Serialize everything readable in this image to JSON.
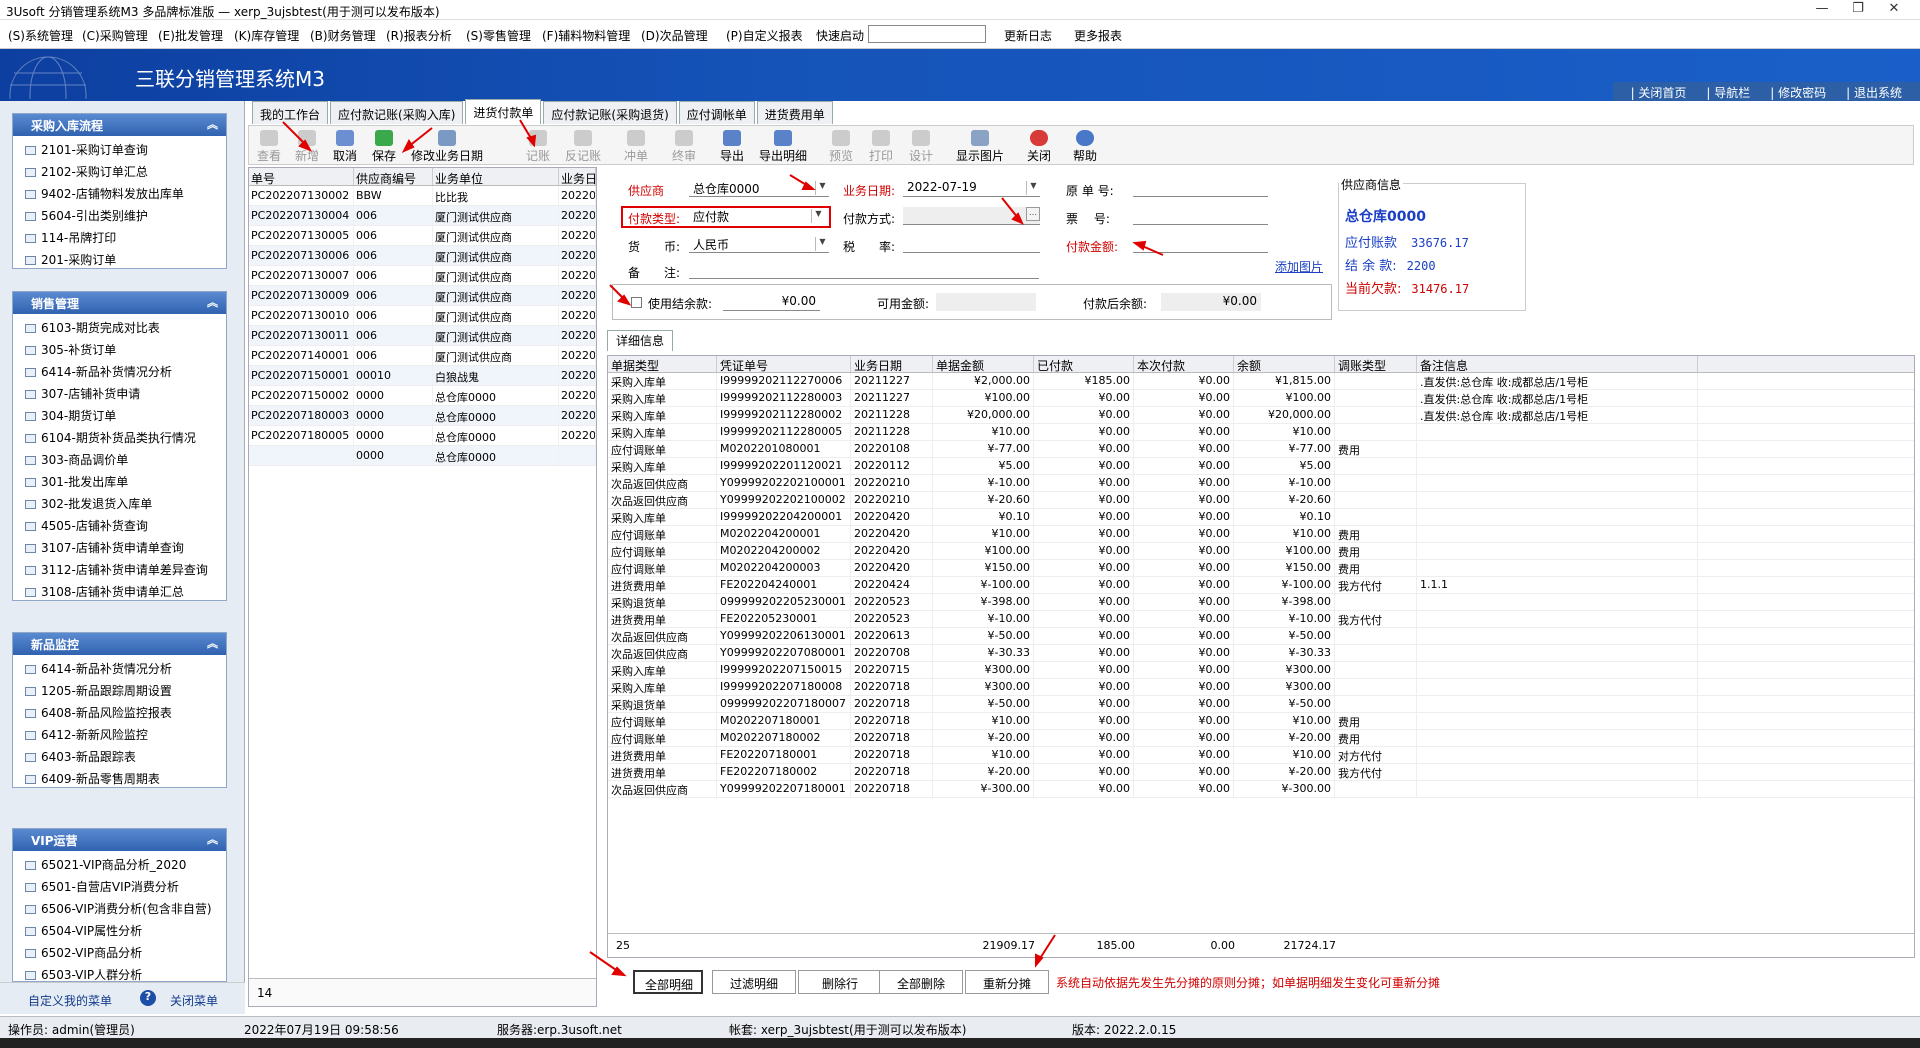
{
  "window": {
    "title": "3Usoft 分销管理系统M3 多品牌标准版 — xerp_3ujsbtest(用于测可以发布版本)"
  },
  "menu": [
    "(S)系统管理",
    "(C)采购管理",
    "(E)批发管理",
    "(K)库存管理",
    "(B)财务管理",
    "(R)报表分析",
    "(S)零售管理",
    "(F)辅料物料管理",
    "(D)次品管理",
    "(P)自定义报表"
  ],
  "quick_label": "快速启动",
  "menu_right": [
    "更新日志",
    "更多报表"
  ],
  "app_name": "三联分销管理系统M3",
  "top_links": [
    "| 关闭首页",
    "| 导航栏",
    "| 修改密码",
    "| 退出系统"
  ],
  "left_sections": [
    {
      "title": "采购入库流程",
      "items": [
        "2101-采购订单查询",
        "2102-采购订单汇总",
        "9402-店铺物料发放出库单",
        "5604-引出类别维护",
        "114-吊牌打印",
        "201-采购订单"
      ]
    },
    {
      "title": "销售管理",
      "items": [
        "6103-期货完成对比表",
        "305-补货订单",
        "6414-新品补货情况分析",
        "307-店铺补货申请",
        "304-期货订单",
        "6104-期货补货品类执行情况",
        "303-商品调价单",
        "301-批发出库单",
        "302-批发退货入库单",
        "4505-店铺补货查询",
        "3107-店铺补货申请单查询",
        "3112-店铺补货申请单差异查询",
        "3108-店铺补货申请单汇总"
      ]
    },
    {
      "title": "新品监控",
      "items": [
        "6414-新品补货情况分析",
        "1205-新品跟踪周期设置",
        "6408-新品风险监控报表",
        "6412-新新风险监控",
        "6403-新品跟踪表",
        "6409-新品零售周期表"
      ]
    },
    {
      "title": "VIP运营",
      "items": [
        "65021-VIP商品分析_2020",
        "6501-自营店VIP消费分析",
        "6506-VIP消费分析(包含非自营)",
        "6504-VIP属性分析",
        "6502-VIP商品分析",
        "6503-VIP人群分析"
      ]
    }
  ],
  "left_footer": {
    "custom": "自定义我的菜单",
    "close": "关闭菜单"
  },
  "tabs": [
    "我的工作台",
    "应付款记账(采购入库)",
    "进货付款单",
    "应付款记账(采购退货)",
    "应付调帐单",
    "进货费用单"
  ],
  "toolbar": [
    "查看",
    "新增",
    "取消",
    "保存",
    "修改业务日期",
    "记账",
    "反记账",
    "冲单",
    "终审",
    "导出",
    "导出明细",
    "预览",
    "打印",
    "设计",
    "显示图片",
    "关闭",
    "帮助"
  ],
  "list": {
    "headers": [
      "单号",
      "供应商编号",
      "业务单位",
      "业务日"
    ],
    "rows": [
      [
        "PC202207130002",
        "BBW",
        "比比我",
        "20220"
      ],
      [
        "PC202207130004",
        "006",
        "厦门测试供应商",
        "20220"
      ],
      [
        "PC202207130005",
        "006",
        "厦门测试供应商",
        "20220"
      ],
      [
        "PC202207130006",
        "006",
        "厦门测试供应商",
        "20220"
      ],
      [
        "PC202207130007",
        "006",
        "厦门测试供应商",
        "20220"
      ],
      [
        "PC202207130009",
        "006",
        "厦门测试供应商",
        "20220"
      ],
      [
        "PC202207130010",
        "006",
        "厦门测试供应商",
        "20220"
      ],
      [
        "PC202207130011",
        "006",
        "厦门测试供应商",
        "20220"
      ],
      [
        "PC202207140001",
        "006",
        "厦门测试供应商",
        "20220"
      ],
      [
        "PC202207150001",
        "00010",
        "白狼战鬼",
        "20220"
      ],
      [
        "PC202207150002",
        "0000",
        "总仓库0000",
        "20220"
      ],
      [
        "PC202207180003",
        "0000",
        "总仓库0000",
        "20220"
      ],
      [
        "PC202207180005",
        "0000",
        "总仓库0000",
        "20220"
      ],
      [
        "",
        "0000",
        "总仓库0000",
        ""
      ]
    ],
    "count": "14"
  },
  "form": {
    "supplier_label": "供应商",
    "supplier_value": "总仓库0000",
    "bizdate_label": "业务日期:",
    "bizdate_value": "2022-07-19",
    "orig_label": "原 单 号:",
    "paytype_label": "付款类型:",
    "paytype_value": "应付款",
    "paymethod_label": "付款方式:",
    "ticket_label": "票　 号:",
    "currency_label": "货　　币:",
    "currency_value": "人民币",
    "tax_label": "税　　率:",
    "amount_label": "付款金额:",
    "remark_label": "备　　注:",
    "add_image": "添加图片",
    "use_balance_label": "使用结余款:",
    "use_balance_value": "¥0.00",
    "available_label": "可用金额:",
    "after_label": "付款后余额:",
    "after_value": "¥0.00"
  },
  "supplier_info": {
    "title": "供应商信息",
    "name": "总仓库0000",
    "payable_label": "应付账款",
    "payable_value": "33676.17",
    "balance_label": "结 余 款:",
    "balance_value": "2200",
    "owed_label": "当前欠款:",
    "owed_value": "31476.17"
  },
  "detail_tab": "详细信息",
  "detail": {
    "headers": [
      "单据类型",
      "凭证单号",
      "业务日期",
      "单据金额",
      "已付款",
      "本次付款",
      "余额",
      "调账类型",
      "备注信息"
    ],
    "rows": [
      [
        "采购入库单",
        "I99999202112270006",
        "20211227",
        "¥2,000.00",
        "¥185.00",
        "¥0.00",
        "¥1,815.00",
        "",
        ".直发供:总仓库 收:成都总店/1号柜"
      ],
      [
        "采购入库单",
        "I99999202112280003",
        "20211227",
        "¥100.00",
        "¥0.00",
        "¥0.00",
        "¥100.00",
        "",
        ".直发供:总仓库 收:成都总店/1号柜"
      ],
      [
        "采购入库单",
        "I99999202112280002",
        "20211228",
        "¥20,000.00",
        "¥0.00",
        "¥0.00",
        "¥20,000.00",
        "",
        ".直发供:总仓库 收:成都总店/1号柜"
      ],
      [
        "采购入库单",
        "I99999202112280005",
        "20211228",
        "¥10.00",
        "¥0.00",
        "¥0.00",
        "¥10.00",
        "",
        ""
      ],
      [
        "应付调账单",
        "M0202201080001",
        "20220108",
        "¥-77.00",
        "¥0.00",
        "¥0.00",
        "¥-77.00",
        "费用",
        ""
      ],
      [
        "采购入库单",
        "I99999202201120021",
        "20220112",
        "¥5.00",
        "¥0.00",
        "¥0.00",
        "¥5.00",
        "",
        ""
      ],
      [
        "次品返回供应商",
        "Y09999202202100001",
        "20220210",
        "¥-10.00",
        "¥0.00",
        "¥0.00",
        "¥-10.00",
        "",
        ""
      ],
      [
        "次品返回供应商",
        "Y09999202202100002",
        "20220210",
        "¥-20.60",
        "¥0.00",
        "¥0.00",
        "¥-20.60",
        "",
        ""
      ],
      [
        "采购入库单",
        "I99999202204200001",
        "20220420",
        "¥0.10",
        "¥0.00",
        "¥0.00",
        "¥0.10",
        "",
        ""
      ],
      [
        "应付调账单",
        "M0202204200001",
        "20220420",
        "¥10.00",
        "¥0.00",
        "¥0.00",
        "¥10.00",
        "费用",
        ""
      ],
      [
        "应付调账单",
        "M0202204200002",
        "20220420",
        "¥100.00",
        "¥0.00",
        "¥0.00",
        "¥100.00",
        "费用",
        ""
      ],
      [
        "应付调账单",
        "M0202204200003",
        "20220420",
        "¥150.00",
        "¥0.00",
        "¥0.00",
        "¥150.00",
        "费用",
        ""
      ],
      [
        "进货费用单",
        "FE202204240001",
        "20220424",
        "¥-100.00",
        "¥0.00",
        "¥0.00",
        "¥-100.00",
        "我方代付",
        "1.1.1"
      ],
      [
        "采购退货单",
        "099999202205230001",
        "20220523",
        "¥-398.00",
        "¥0.00",
        "¥0.00",
        "¥-398.00",
        "",
        ""
      ],
      [
        "进货费用单",
        "FE202205230001",
        "20220523",
        "¥-10.00",
        "¥0.00",
        "¥0.00",
        "¥-10.00",
        "我方代付",
        ""
      ],
      [
        "次品返回供应商",
        "Y09999202206130001",
        "20220613",
        "¥-50.00",
        "¥0.00",
        "¥0.00",
        "¥-50.00",
        "",
        ""
      ],
      [
        "次品返回供应商",
        "Y09999202207080001",
        "20220708",
        "¥-30.33",
        "¥0.00",
        "¥0.00",
        "¥-30.33",
        "",
        ""
      ],
      [
        "采购入库单",
        "I99999202207150015",
        "20220715",
        "¥300.00",
        "¥0.00",
        "¥0.00",
        "¥300.00",
        "",
        ""
      ],
      [
        "采购入库单",
        "I99999202207180008",
        "20220718",
        "¥300.00",
        "¥0.00",
        "¥0.00",
        "¥300.00",
        "",
        ""
      ],
      [
        "采购退货单",
        "099999202207180007",
        "20220718",
        "¥-50.00",
        "¥0.00",
        "¥0.00",
        "¥-50.00",
        "",
        ""
      ],
      [
        "应付调账单",
        "M0202207180001",
        "20220718",
        "¥10.00",
        "¥0.00",
        "¥0.00",
        "¥10.00",
        "费用",
        ""
      ],
      [
        "应付调账单",
        "M0202207180002",
        "20220718",
        "¥-20.00",
        "¥0.00",
        "¥0.00",
        "¥-20.00",
        "费用",
        ""
      ],
      [
        "进货费用单",
        "FE202207180001",
        "20220718",
        "¥10.00",
        "¥0.00",
        "¥0.00",
        "¥10.00",
        "对方代付",
        ""
      ],
      [
        "进货费用单",
        "FE202207180002",
        "20220718",
        "¥-20.00",
        "¥0.00",
        "¥0.00",
        "¥-20.00",
        "我方代付",
        ""
      ],
      [
        "次品返回供应商",
        "Y09999202207180001",
        "20220718",
        "¥-300.00",
        "¥0.00",
        "¥0.00",
        "¥-300.00",
        "",
        ""
      ]
    ],
    "summary": {
      "count": "25",
      "amount": "21909.17",
      "paid": "185.00",
      "this": "0.00",
      "balance": "21724.17"
    }
  },
  "buttons": [
    "全部明细",
    "过滤明细",
    "删除行",
    "全部删除",
    "重新分摊"
  ],
  "hint": "系统自动依据先发生先分摊的原则分摊；如单据明细发生变化可重新分摊",
  "status": {
    "operator": "操作员: admin(管理员)",
    "datetime": "2022年07月19日 09:58:56",
    "server": "服务器:erp.3usoft.net",
    "account": "帐套: xerp_3ujsbtest(用于测可以发布版本)",
    "version": "版本: 2022.2.0.15"
  }
}
